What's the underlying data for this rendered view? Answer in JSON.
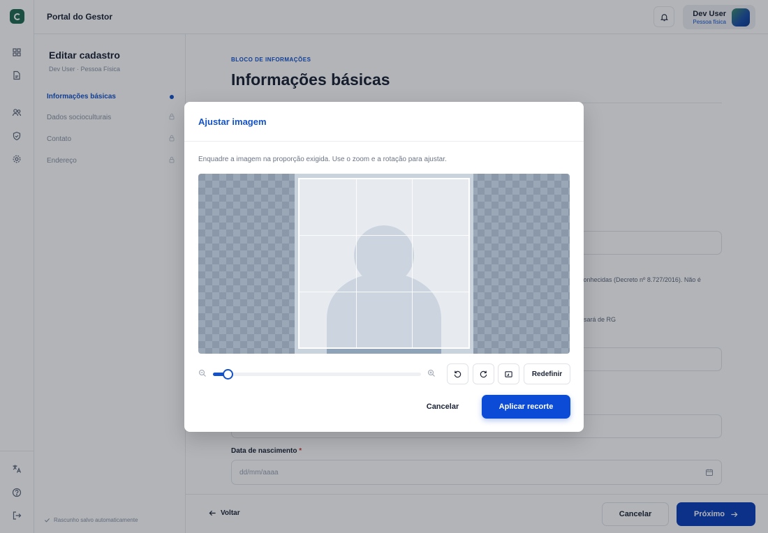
{
  "header": {
    "title": "Portal do Gestor",
    "user_name": "Dev User",
    "user_type": "Pessoa física"
  },
  "form_sidebar": {
    "title": "Editar cadastro",
    "subtitle": "Dev User · Pessoa Física",
    "items": [
      {
        "label": "Informações básicas",
        "state": "active"
      },
      {
        "label": "Dados socioculturais",
        "state": "locked"
      },
      {
        "label": "Contato",
        "state": "locked"
      },
      {
        "label": "Endereço",
        "state": "locked"
      }
    ],
    "autosave": "Rascunho salvo automaticamente"
  },
  "main": {
    "eyebrow": "BLOCO DE INFORMAÇÕES",
    "title": "Informações básicas",
    "partial_text_1": "conhecidas (Decreto nº 8.727/2016). Não é",
    "partial_text_2": "usará de RG",
    "birth_label": "Data de nascimento",
    "birth_required": "*",
    "birth_placeholder": "dd/mm/aaaa"
  },
  "footer": {
    "back_label": "Voltar",
    "cancel_label": "Cancelar",
    "next_label": "Próximo"
  },
  "modal": {
    "title": "Ajustar imagem",
    "description": "Enquadre a imagem na proporção exigida. Use o zoom e a rotação para ajustar.",
    "zoom_level": 0.07,
    "reset_label": "Redefinir",
    "cancel_label": "Cancelar",
    "apply_label": "Aplicar recorte"
  },
  "colors": {
    "accent": "#1452c9",
    "primary_button": "#0b4bd6",
    "brand": "#1f6b52"
  },
  "icons": {
    "rail": [
      "grid-icon",
      "document-icon",
      "users-icon",
      "shield-icon",
      "gear-icon",
      "translate-icon",
      "help-icon",
      "logout-icon"
    ]
  }
}
